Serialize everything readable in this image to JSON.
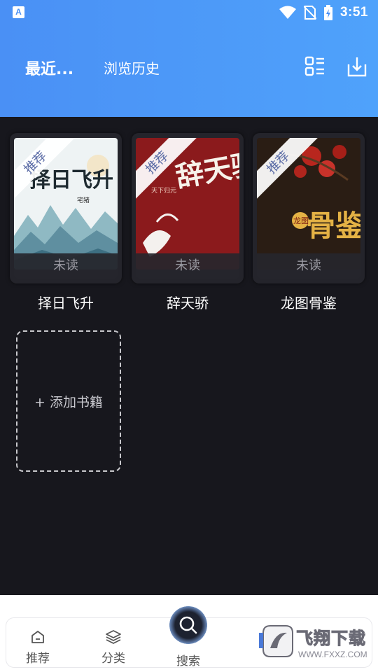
{
  "status_bar": {
    "app_badge": "A",
    "time": "3:51",
    "icons": [
      "wifi-icon",
      "no-sim-icon",
      "battery-charging-icon"
    ]
  },
  "header": {
    "tabs": [
      {
        "label": "最近..."
      },
      {
        "label": "浏览历史"
      }
    ],
    "actions": [
      "grid-view-icon",
      "download-icon"
    ]
  },
  "shelf": {
    "books": [
      {
        "title": "择日飞升",
        "badge": "推荐",
        "status": "未读",
        "cover_text": "择日飞升",
        "cover_author": "宅猪"
      },
      {
        "title": "辞天骄",
        "badge": "推荐",
        "status": "未读",
        "cover_text": "辞天骄",
        "cover_author": "天下归元"
      },
      {
        "title": "龙图骨鉴",
        "badge": "推荐",
        "status": "未读",
        "cover_text": "骨鉴",
        "cover_author": "龙图"
      }
    ],
    "add_label": "+ 添加书籍"
  },
  "bottom_nav": {
    "items": [
      {
        "label": "推荐",
        "icon": "home-icon"
      },
      {
        "label": "分类",
        "icon": "layers-icon"
      },
      {
        "label": "搜索",
        "icon": "search-icon"
      }
    ],
    "watermark": {
      "text": "飞翔下载",
      "url": "WWW.FXXZ.COM"
    }
  },
  "colors": {
    "header_start": "#4a90f5",
    "header_end": "#4fa2fb",
    "background": "#17171d",
    "ribbon_text": "#5a6ba5"
  }
}
